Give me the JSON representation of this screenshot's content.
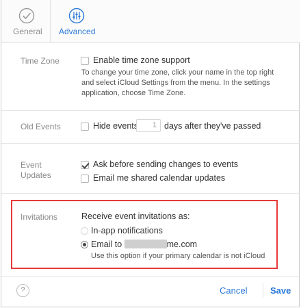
{
  "toolbar": {
    "tabs": [
      {
        "label": "General",
        "icon": "check-circle-icon",
        "active": false
      },
      {
        "label": "Advanced",
        "icon": "sliders-icon",
        "active": true
      }
    ]
  },
  "time_zone": {
    "label": "Time Zone",
    "checkbox_label": "Enable time zone support",
    "checked": false,
    "hint": "To change your time zone, click your name in the top right and select iCloud Settings from the menu. In the settings application, choose Time Zone."
  },
  "old_events": {
    "label": "Old Events",
    "checkbox_prefix": "Hide events",
    "days_value": "1",
    "checkbox_suffix": "days after they've passed",
    "checked": false
  },
  "event_updates": {
    "label_line1": "Event",
    "label_line2": "Updates",
    "options": [
      {
        "label": "Ask before sending changes to events",
        "checked": true
      },
      {
        "label": "Email me shared calendar updates",
        "checked": false
      }
    ]
  },
  "invitations": {
    "label": "Invitations",
    "heading": "Receive event invitations as:",
    "options": [
      {
        "label": "In-app notifications",
        "selected": false,
        "disabled": true
      },
      {
        "label_prefix": "Email to",
        "label_suffix": "me.com",
        "selected": true
      }
    ],
    "hint": "Use this option if your primary calendar is not iCloud"
  },
  "footer": {
    "help_label": "?",
    "cancel_label": "Cancel",
    "save_label": "Save"
  },
  "colors": {
    "accent": "#2b79d8",
    "highlight_border": "#e6393b",
    "muted_label": "#8a8a8a"
  }
}
